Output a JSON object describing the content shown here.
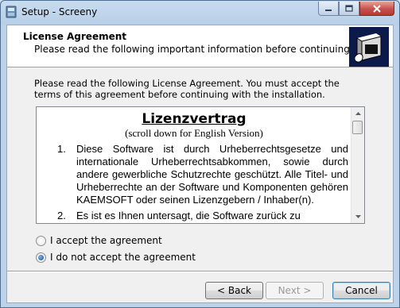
{
  "window": {
    "title": "Setup - Screeny",
    "controls": {
      "minimize": "minimize-icon",
      "maximize": "maximize-icon",
      "close": "close-icon"
    }
  },
  "header": {
    "title": "License Agreement",
    "subtitle": "Please read the following important information before continuing."
  },
  "intro": "Please read the following License Agreement. You must accept the terms of this agreement before continuing with the installation.",
  "license": {
    "heading": "Lizenzvertrag",
    "subheading": "(scroll down for English Version)",
    "items": [
      {
        "num": "1.",
        "text": "Diese Software ist durch Urheberrechtsgesetze und internationale Urheberrechtsabkommen, sowie durch andere gewerbliche Schutzrechte geschützt. Alle Titel- und Urheberrechte an der Software und Komponenten gehören KAEMSOFT oder seinen Lizenzgebern / Inhaber(n)."
      },
      {
        "num": "2.",
        "text": "Es ist es Ihnen untersagt, die Software zurück zu"
      }
    ]
  },
  "options": {
    "accept": "I accept the agreement",
    "decline": "I do not accept the agreement",
    "selected": "decline"
  },
  "buttons": {
    "back": "< Back",
    "next": "Next >",
    "cancel": "Cancel"
  }
}
